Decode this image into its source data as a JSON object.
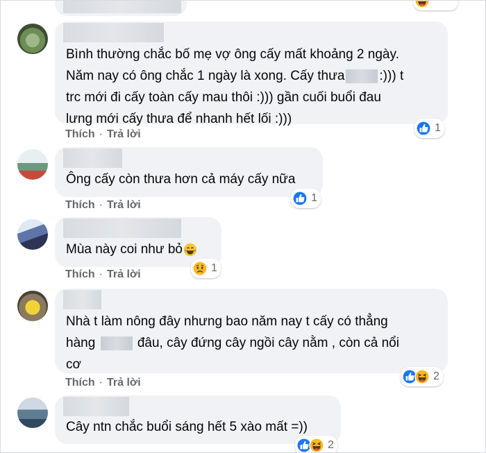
{
  "comments": [
    {
      "lines": [
        "Bình thường chắc bố mẹ vợ ông cấy mất khoảng 2 ngày.",
        "Năm nay có ông chắc 1 ngày là xong. Cấy thưa",
        ":))) t",
        "trc mới đi cấy toàn cấy mau thôi :))) gần cuối buổi đau",
        "lưng mới cấy thưa để nhanh hết lối :)))"
      ],
      "like_label": "Thích",
      "reply_label": "Trả lời",
      "reaction_icons": [
        "like-icon"
      ],
      "reaction_count": "1"
    },
    {
      "lines": [
        "Ông cấy còn thưa hơn cả máy cấy nữa"
      ],
      "like_label": "Thích",
      "reply_label": "Trả lời",
      "reaction_icons": [
        "like-icon"
      ],
      "reaction_count": "1"
    },
    {
      "lines": [
        "Mùa này coi như bỏ"
      ],
      "inline_emoji": "laughing-crying-emoji",
      "like_label": "Thích",
      "reply_label": "Trả lời",
      "reaction_icons": [
        "sad-icon"
      ],
      "reaction_count": "1"
    },
    {
      "lines": [
        "Nhà t làm nông đây nhưng bao năm nay t cấy có thẳng",
        "hàng",
        "đâu, cây đứng cây ngồi cây nằm , còn cả nổi",
        "cơ"
      ],
      "like_label": "Thích",
      "reply_label": "Trả lời",
      "reaction_icons": [
        "like-icon",
        "haha-icon"
      ],
      "reaction_count": "2"
    },
    {
      "lines": [
        "Cây ntn chắc buổi sáng hết 5 xào mất =))"
      ],
      "reaction_icons": [
        "like-icon",
        "haha-icon"
      ],
      "reaction_count": "2"
    }
  ],
  "colors": {
    "bubble": "#f0f2f5",
    "like_blue": "#1877f2",
    "haha_yellow": "#f7b928",
    "meta_gray": "#65676b",
    "text": "#050505"
  }
}
